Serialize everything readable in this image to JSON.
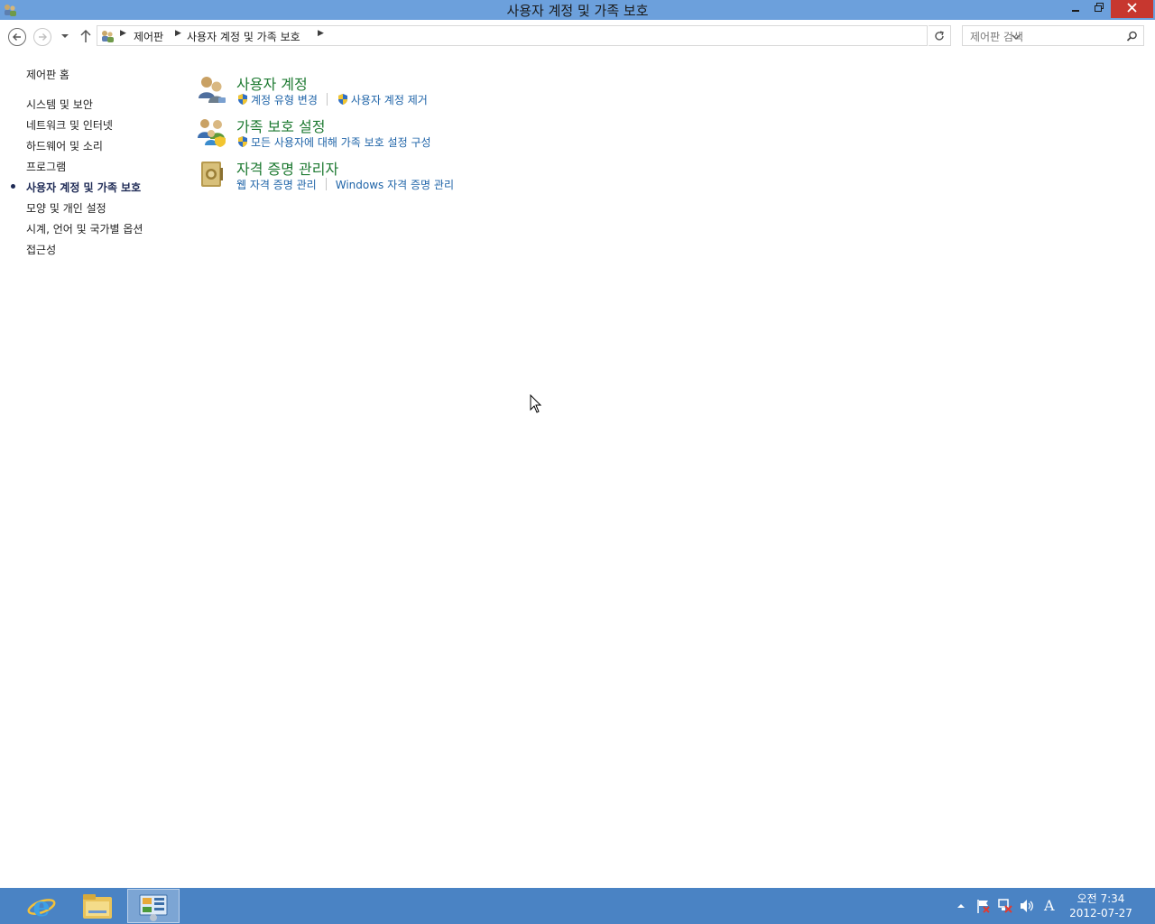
{
  "window": {
    "title": "사용자 계정 및 가족 보호",
    "min_icon": "minimize-icon",
    "max_icon": "restore-icon",
    "close_icon": "close-icon"
  },
  "address": {
    "breadcrumbs": [
      "제어판",
      "사용자 계정 및 가족 보호"
    ],
    "search_placeholder": "제어판 검색"
  },
  "sidebar": {
    "home": "제어판 홈",
    "items": [
      {
        "label": "시스템 및 보안"
      },
      {
        "label": "네트워크 및 인터넷"
      },
      {
        "label": "하드웨어 및 소리"
      },
      {
        "label": "프로그램"
      },
      {
        "label": "사용자 계정 및 가족 보호",
        "current": true
      },
      {
        "label": "모양 및 개인 설정"
      },
      {
        "label": "시계, 언어 및 국가별 옵션"
      },
      {
        "label": "접근성"
      }
    ]
  },
  "categories": [
    {
      "title": "사용자 계정",
      "icon": "user-accounts-icon",
      "links": [
        {
          "label": "계정 유형 변경",
          "shield": true
        },
        {
          "label": "사용자 계정 제거",
          "shield": true
        }
      ]
    },
    {
      "title": "가족 보호 설정",
      "icon": "family-safety-icon",
      "links": [
        {
          "label": "모든 사용자에 대해 가족 보호 설정 구성",
          "shield": true
        }
      ]
    },
    {
      "title": "자격 증명 관리자",
      "icon": "credential-manager-icon",
      "links": [
        {
          "label": "웹 자격 증명 관리",
          "shield": false
        },
        {
          "label": "Windows 자격 증명 관리",
          "shield": false
        }
      ]
    }
  ],
  "taskbar": {
    "apps": [
      "internet-explorer-icon",
      "file-explorer-icon",
      "control-panel-icon"
    ],
    "ime": "A",
    "time": "오전 7:34",
    "date": "2012-07-27"
  },
  "colors": {
    "titlebar": "#6ca0dc",
    "taskbar": "#4a83c4",
    "category_title": "#1e7a32",
    "link": "#1f64a8"
  }
}
